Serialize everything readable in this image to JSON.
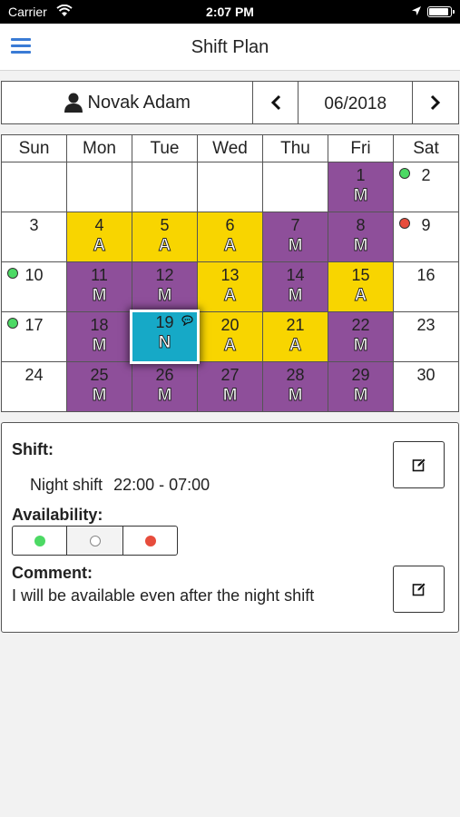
{
  "status_bar": {
    "carrier": "Carrier",
    "time": "2:07 PM"
  },
  "nav": {
    "title": "Shift Plan"
  },
  "header": {
    "user_name": "Novak Adam",
    "month": "06/2018"
  },
  "calendar": {
    "weekdays": [
      "Sun",
      "Mon",
      "Tue",
      "Wed",
      "Thu",
      "Fri",
      "Sat"
    ],
    "colors": {
      "purple": "#8e4f9a",
      "yellow": "#f8d500",
      "selected": "#16a9c7",
      "available": "#4cd964",
      "unavailable": "#e74c3c"
    },
    "weeks": [
      [
        {},
        {},
        {},
        {},
        {},
        {
          "day": "1",
          "shift": "M",
          "color": "purple"
        },
        {
          "day": "2",
          "availability": "green"
        }
      ],
      [
        {
          "day": "3"
        },
        {
          "day": "4",
          "shift": "A",
          "color": "yellow"
        },
        {
          "day": "5",
          "shift": "A",
          "color": "yellow"
        },
        {
          "day": "6",
          "shift": "A",
          "color": "yellow"
        },
        {
          "day": "7",
          "shift": "M",
          "color": "purple"
        },
        {
          "day": "8",
          "shift": "M",
          "color": "purple"
        },
        {
          "day": "9",
          "availability": "red"
        }
      ],
      [
        {
          "day": "10",
          "availability": "green"
        },
        {
          "day": "11",
          "shift": "M",
          "color": "purple"
        },
        {
          "day": "12",
          "shift": "M",
          "color": "purple"
        },
        {
          "day": "13",
          "shift": "A",
          "color": "yellow"
        },
        {
          "day": "14",
          "shift": "M",
          "color": "purple"
        },
        {
          "day": "15",
          "shift": "A",
          "color": "yellow"
        },
        {
          "day": "16"
        }
      ],
      [
        {
          "day": "17",
          "availability": "green"
        },
        {
          "day": "18",
          "shift": "M",
          "color": "purple"
        },
        {
          "day": "19",
          "shift": "N",
          "color": "selected",
          "selected": true,
          "has_comment": true
        },
        {
          "day": "20",
          "shift": "A",
          "color": "yellow"
        },
        {
          "day": "21",
          "shift": "A",
          "color": "yellow"
        },
        {
          "day": "22",
          "shift": "M",
          "color": "purple"
        },
        {
          "day": "23"
        }
      ],
      [
        {
          "day": "24"
        },
        {
          "day": "25",
          "shift": "M",
          "color": "purple"
        },
        {
          "day": "26",
          "shift": "M",
          "color": "purple"
        },
        {
          "day": "27",
          "shift": "M",
          "color": "purple"
        },
        {
          "day": "28",
          "shift": "M",
          "color": "purple"
        },
        {
          "day": "29",
          "shift": "M",
          "color": "purple"
        },
        {
          "day": "30"
        }
      ]
    ]
  },
  "detail": {
    "shift_label": "Shift:",
    "shift_name": "Night shift",
    "shift_time": "22:00 - 07:00",
    "availability_label": "Availability:",
    "availability_options": [
      "available",
      "neutral",
      "unavailable"
    ],
    "comment_label": "Comment:",
    "comment_text": "I will be available even after the night shift"
  }
}
